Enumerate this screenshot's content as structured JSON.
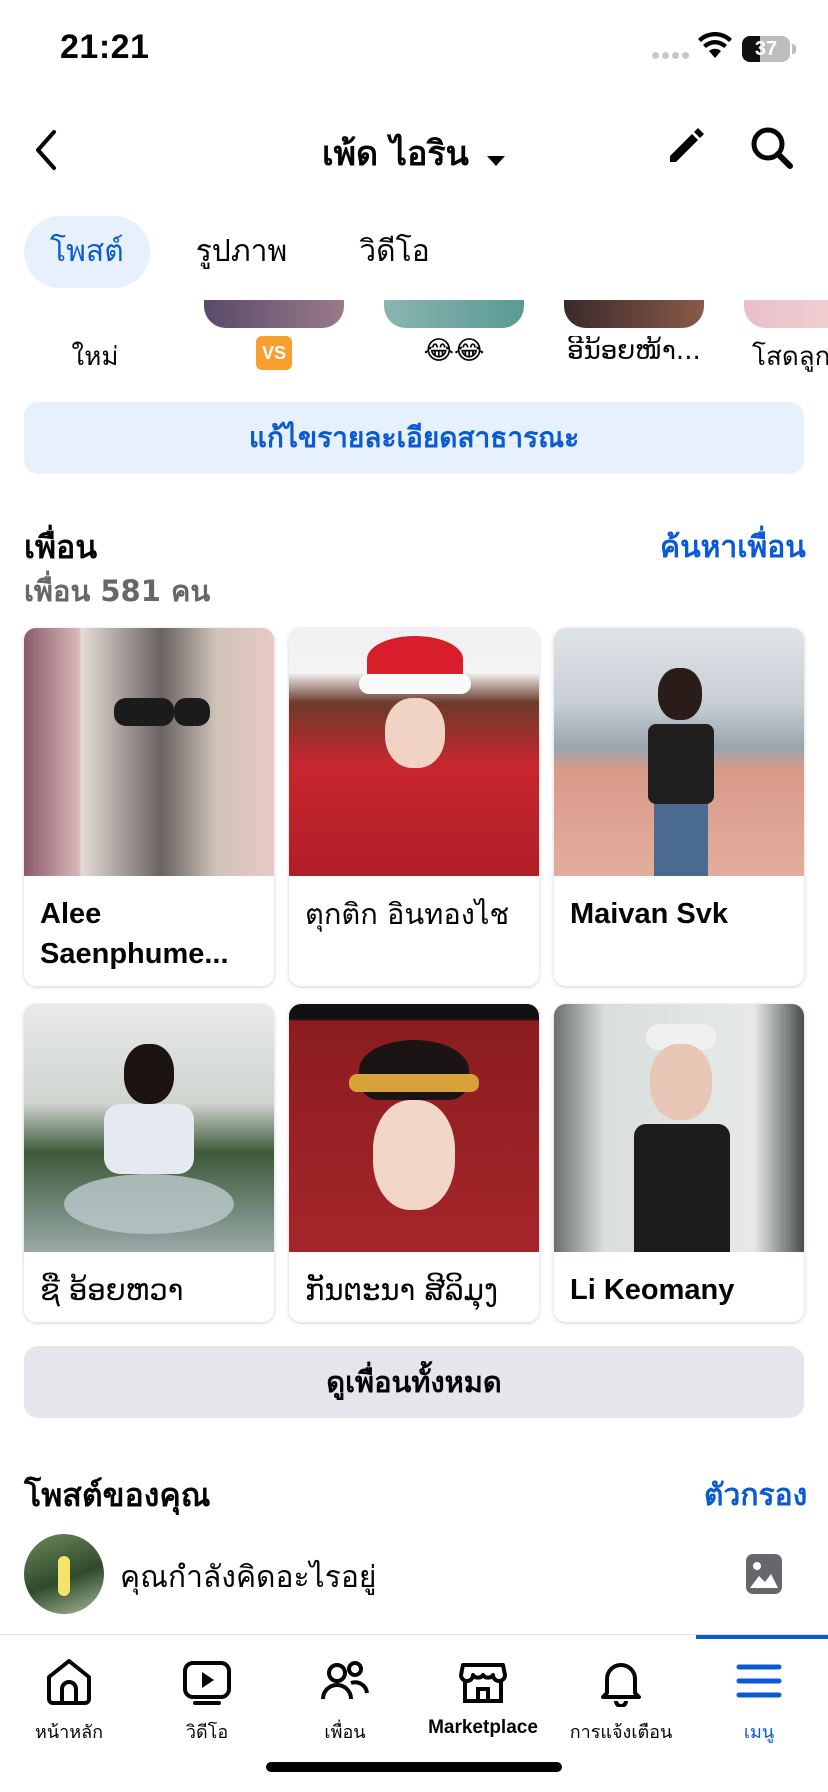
{
  "status_bar": {
    "time": "21:21",
    "battery": "37"
  },
  "header": {
    "title": "เพ้ด ไอริน"
  },
  "tabs": [
    {
      "label": "โพสต์",
      "active": true
    },
    {
      "label": "รูปภาพ",
      "active": false
    },
    {
      "label": "วิดีโอ",
      "active": false
    }
  ],
  "stories": [
    {
      "label": "ใหม่"
    },
    {
      "label": "VS"
    },
    {
      "label": "😂😂"
    },
    {
      "label": "ອີນ້ອຍໜ້າ..."
    },
    {
      "label": "โสดลูกวี"
    }
  ],
  "edit_public": {
    "label": "แก้ไขรายละเอียดสาธารณะ"
  },
  "friends": {
    "title": "เพื่อน",
    "count": "เพื่อน 581 คน",
    "find_label": "ค้นหาเพื่อน",
    "items": [
      {
        "name": "Alee Saenphume..."
      },
      {
        "name": "ตุกติก อินทองไช"
      },
      {
        "name": "Maivan Svk"
      },
      {
        "name": "ຊື ອ້ອຍຫວາ"
      },
      {
        "name": "ກັນຕະນາ ສີລິມຸງຄູນ"
      },
      {
        "name": "Li Keomany"
      }
    ],
    "see_all": "ดูเพื่อนทั้งหมด"
  },
  "posts": {
    "title": "โพสต์ของคุณ",
    "filter_label": "ตัวกรอง",
    "composer_placeholder": "คุณกำลังคิดอะไรอยู่"
  },
  "bottom_nav": [
    {
      "label": "หน้าหลัก",
      "icon": "home-icon",
      "active": false
    },
    {
      "label": "วิดีโอ",
      "icon": "video-icon",
      "active": false
    },
    {
      "label": "เพื่อน",
      "icon": "friends-icon",
      "active": false
    },
    {
      "label": "Marketplace",
      "icon": "marketplace-icon",
      "active": false
    },
    {
      "label": "การแจ้งเตือน",
      "icon": "bell-icon",
      "active": false
    },
    {
      "label": "เมนู",
      "icon": "menu-icon",
      "active": true
    }
  ],
  "colors": {
    "accent": "#0a5bd3",
    "accent_bg": "#e7f0fd",
    "secondary_button": "#e4e6eb"
  }
}
